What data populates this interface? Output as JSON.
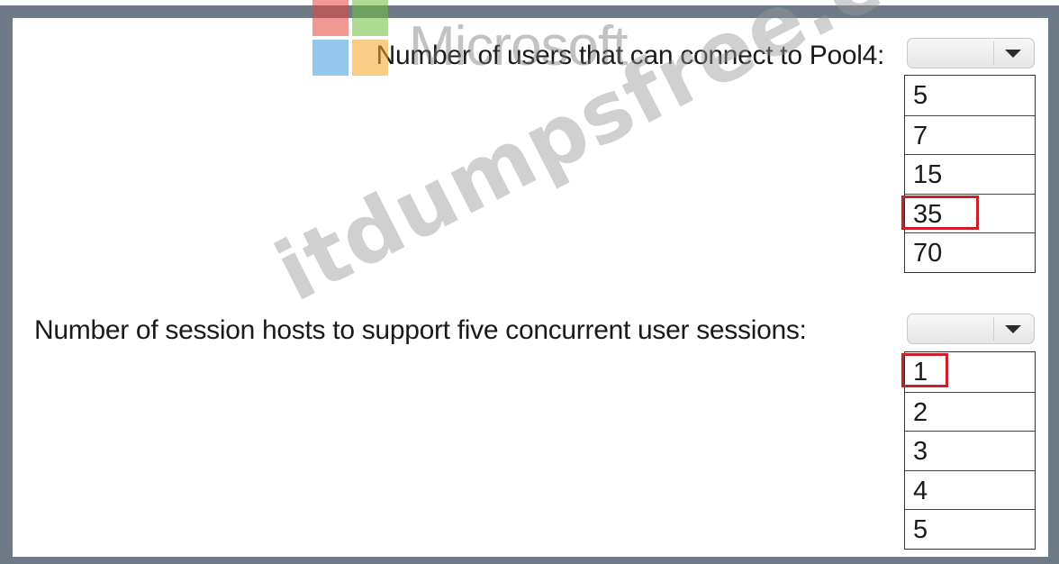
{
  "watermark": {
    "logo_text": "Microsoft",
    "site_text": "itdumpsfree.com"
  },
  "question1": {
    "label": "Number of users that can connect to Pool4:",
    "selected_value": "",
    "options": [
      "5",
      "7",
      "15",
      "35",
      "70"
    ],
    "highlighted_option": "35"
  },
  "question2": {
    "label": "Number of session hosts to support five concurrent user sessions:",
    "selected_value": "",
    "options": [
      "1",
      "2",
      "3",
      "4",
      "5"
    ],
    "highlighted_option": "1"
  },
  "colors": {
    "frame": "#6f7a87",
    "highlight": "#cc1f25"
  }
}
